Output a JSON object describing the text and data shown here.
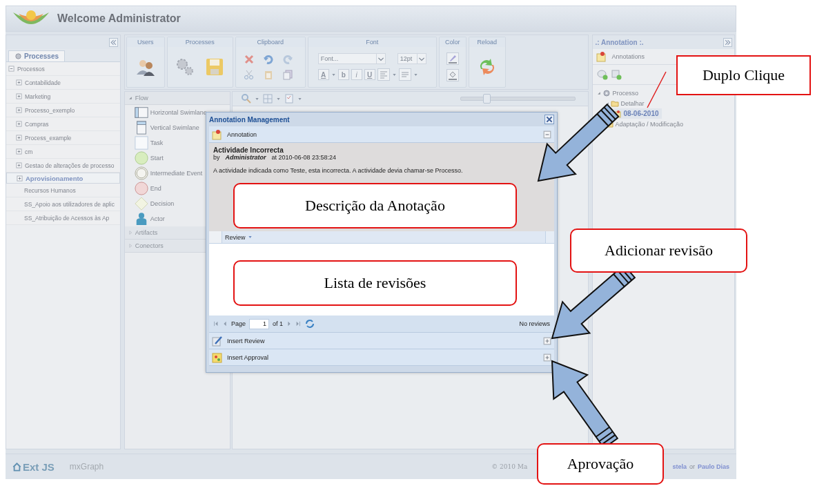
{
  "header": {
    "title": "Welcome Administrator"
  },
  "left_panel": {
    "tabs": [
      {
        "label": "Processes",
        "selected": true
      }
    ],
    "tree": {
      "label": "Processos",
      "expanded": true,
      "children": [
        {
          "label": "Contabilidade",
          "has_children": true,
          "selected": false
        },
        {
          "label": "Marketing",
          "has_children": true,
          "selected": false
        },
        {
          "label": "Processo_exemplo",
          "has_children": true,
          "selected": false
        },
        {
          "label": "Compras",
          "has_children": true,
          "selected": false
        },
        {
          "label": "Process_example",
          "has_children": true,
          "selected": false
        },
        {
          "label": "cm",
          "has_children": true,
          "selected": false
        },
        {
          "label": "Gestao de alterações de processo",
          "has_children": true,
          "selected": false
        },
        {
          "label": "Aprovisionamento",
          "has_children": true,
          "selected": true
        },
        {
          "label": "Recursos Humanos",
          "has_children": false,
          "selected": false
        },
        {
          "label": "SS_Apoio aos utilizadores de aplic",
          "has_children": false,
          "selected": false
        },
        {
          "label": "SS_Atribuição de Acessos às Ap",
          "has_children": false,
          "selected": false
        }
      ]
    }
  },
  "ribbon": {
    "groups": [
      {
        "title": "Users",
        "kind": "users"
      },
      {
        "title": "Processes",
        "kind": "processes"
      },
      {
        "title": "Clipboard",
        "kind": "clipboard"
      },
      {
        "title": "Font",
        "kind": "font",
        "font_placeholder": "Font...",
        "size_placeholder": "12pt",
        "color_button": "A",
        "format_buttons": [
          "b",
          "i",
          "U"
        ]
      },
      {
        "title": "Color",
        "kind": "color"
      },
      {
        "title": "Reload",
        "kind": "reload"
      }
    ]
  },
  "palette": {
    "sections": [
      {
        "label": "Flow",
        "expanded": true,
        "items": [
          {
            "label": "Horizontal Swimlane",
            "kind": "hswimlane"
          },
          {
            "label": "Vertical Swimlane",
            "kind": "vswimlane"
          },
          {
            "label": "Task",
            "kind": "task"
          },
          {
            "label": "Start",
            "kind": "start"
          },
          {
            "label": "Intermediate Event",
            "kind": "intermediate"
          },
          {
            "label": "End",
            "kind": "end"
          },
          {
            "label": "Decision",
            "kind": "decision"
          },
          {
            "label": "Actor",
            "kind": "actor"
          }
        ]
      },
      {
        "label": "Artifacts",
        "expanded": false
      },
      {
        "label": "Conectors",
        "expanded": false
      }
    ]
  },
  "canvas": {
    "zoom_slider": {
      "level": 0.22
    }
  },
  "dialog": {
    "title": "Annotation Management",
    "panel_title": "Annotation",
    "annotation": {
      "title": "Actividade Incorrecta",
      "by": "by",
      "author": "Administrator",
      "timestamp": "at 2010-06-08 23:58:24",
      "description": "A actividade indicada como Teste, esta incorrecta. A actividade devia chamar-se Processo."
    },
    "grid": {
      "columns": [
        "Review"
      ]
    },
    "pager": {
      "page_label": "Page",
      "page": "1",
      "of": "of 1",
      "status": "No reviews"
    },
    "actions": [
      {
        "label": "Insert Review",
        "kind": "review"
      },
      {
        "label": "Insert Approval",
        "kind": "approval"
      }
    ]
  },
  "right_panel": {
    "title": ".: Annotation :.",
    "section": "Annotations",
    "tree": [
      {
        "label": "Processo",
        "kind": "process",
        "selected": false,
        "children": [
          {
            "label": "Detalhar",
            "kind": "folder",
            "selected": false,
            "children": [
              {
                "label": "08-06-2010",
                "kind": "note",
                "selected": true
              }
            ]
          },
          {
            "label": "Adaptação / Modificação",
            "kind": "folder",
            "selected": false
          }
        ]
      }
    ]
  },
  "footer": {
    "logos": [
      "Ext JS",
      "mxGraph"
    ],
    "copyright": "© 2010 Ma",
    "credits": [
      "stela",
      "or",
      "Paulo Dias"
    ]
  },
  "callouts": [
    {
      "text": "Duplo Clique",
      "kind": "rect"
    },
    {
      "text": "Descrição da Anotação",
      "kind": "rounded"
    },
    {
      "text": "Lista de revisões",
      "kind": "rounded"
    },
    {
      "text": "Adicionar revisão",
      "kind": "rounded"
    },
    {
      "text": "Aprovação",
      "kind": "rounded"
    }
  ]
}
